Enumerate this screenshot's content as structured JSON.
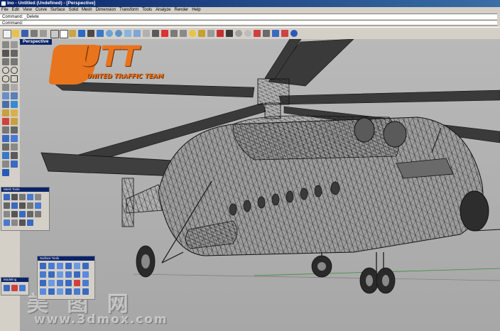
{
  "title": "ino - Untitled (Undefined) - [Perspective]",
  "menu": [
    "File",
    "Edit",
    "View",
    "Curve",
    "Surface",
    "Solid",
    "Mesh",
    "Dimension",
    "Transform",
    "Tools",
    "Analyze",
    "Render",
    "Help"
  ],
  "command_history": "Command: _Delete",
  "command_prompt": "Command:",
  "viewport_label": "Perspective",
  "logo": {
    "brand": "UTT",
    "tagline": "UNITED TRAFFIC TEAM"
  },
  "panels": {
    "mesh_tools": "Mesh Tools",
    "surface_tools": "Surface Tools",
    "modeling": "Modeling"
  },
  "watermark": {
    "cn": "美 图 网",
    "url": "www.3dmox.com"
  },
  "colors": {
    "title_bar": "#0a246a",
    "logo_orange": "#e8741e",
    "viewport_bg": "#b4b4b4",
    "wireframe": "#1a1a1a"
  }
}
